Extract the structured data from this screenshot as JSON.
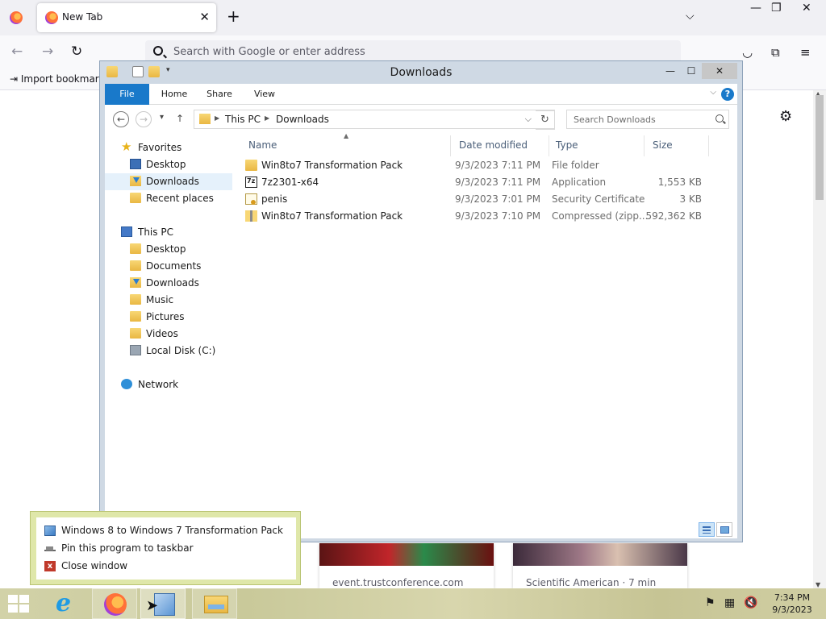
{
  "firefox": {
    "tab_title": "New Tab",
    "tab_close": "✕",
    "new_tab": "+",
    "list_all_tabs": "⌵",
    "minimize": "—",
    "restore": "❐",
    "close": "✕",
    "back": "←",
    "forward": "→",
    "reload": "↻",
    "url_placeholder": "Search with Google or enter address",
    "pocket": "◡",
    "extensions": "⧉",
    "menu": "≡",
    "bookmark_import": "⇥ Import bookmarks…",
    "settings": "⚙",
    "cards": [
      {
        "source": "event.trustconference.com"
      },
      {
        "source": "Scientific American · 7 min"
      }
    ]
  },
  "explorer": {
    "title": "Downloads",
    "minimize": "—",
    "maximize": "☐",
    "close": "✕",
    "ribbon_tabs": [
      "File",
      "Home",
      "Share",
      "View"
    ],
    "help": "?",
    "collapse": "⌵",
    "nav": {
      "back": "←",
      "forward": "→",
      "recent": "▾",
      "up": "↑"
    },
    "breadcrumb": [
      "This PC",
      "Downloads"
    ],
    "refresh": "↻",
    "search_placeholder": "Search Downloads",
    "sidebar": [
      {
        "label": "Favorites"
      },
      {
        "label": "Desktop"
      },
      {
        "label": "Downloads"
      },
      {
        "label": "Recent places"
      },
      {
        "label": "This PC"
      },
      {
        "label": "Desktop"
      },
      {
        "label": "Documents"
      },
      {
        "label": "Downloads"
      },
      {
        "label": "Music"
      },
      {
        "label": "Pictures"
      },
      {
        "label": "Videos"
      },
      {
        "label": "Local Disk (C:)"
      },
      {
        "label": "Network"
      }
    ],
    "columns": [
      "Name",
      "Date modified",
      "Type",
      "Size"
    ],
    "files": [
      {
        "name": "Win8to7 Transformation Pack",
        "date": "9/3/2023 7:11 PM",
        "type": "File folder",
        "size": ""
      },
      {
        "name": "7z2301-x64",
        "date": "9/3/2023 7:11 PM",
        "type": "Application",
        "size": "1,553 KB"
      },
      {
        "name": "penis",
        "date": "9/3/2023 7:01 PM",
        "type": "Security Certificate",
        "size": "3 KB"
      },
      {
        "name": "Win8to7 Transformation Pack",
        "date": "9/3/2023 7:10 PM",
        "type": "Compressed (zipp...",
        "size": "592,362 KB"
      }
    ]
  },
  "jumplist": {
    "items": [
      {
        "label": "Windows 8 to Windows 7 Transformation Pack"
      },
      {
        "label": "Pin this program to taskbar"
      },
      {
        "label": "Close window"
      }
    ],
    "close_glyph": "x"
  },
  "taskbar": {
    "ie_glyph": "e",
    "clock_time": "7:34 PM",
    "clock_date": "9/3/2023",
    "tray_flag": "⚑",
    "tray_network": "▦",
    "tray_volume": "🔇"
  }
}
